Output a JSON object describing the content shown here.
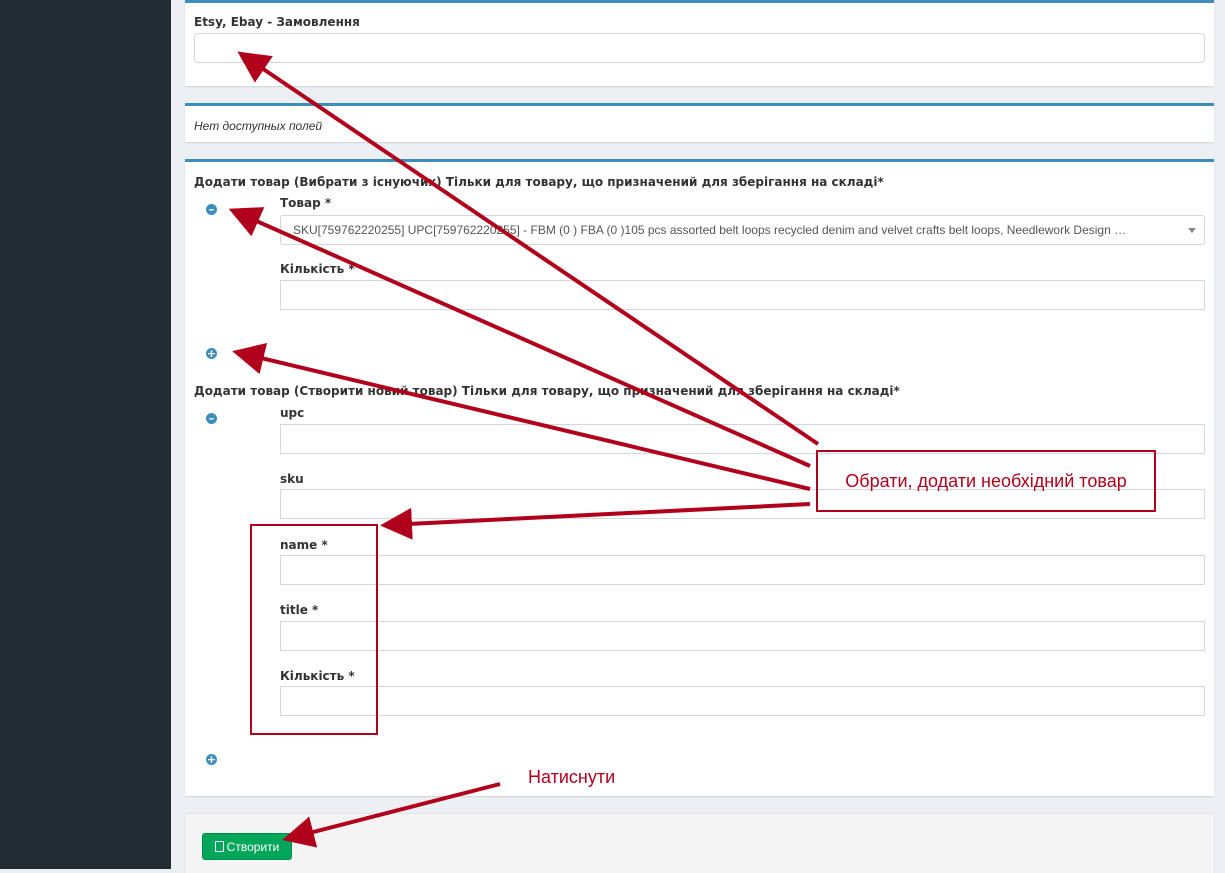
{
  "form": {
    "orders_label": "Etsy, Ebay - Замовлення",
    "orders_value": "",
    "no_fields_text": "Нет доступных полей",
    "existing_section_title": "Додати товар (Вибрати з існуючих) Тільки для товару, що призначений для зберігання на складі*",
    "product_label": "Товар *",
    "product_selected": "SKU[759762220255] UPC[759762220255] - FBM (0 ) FBA (0 )105 pcs assorted belt loops recycled denim and velvet crafts belt loops, Needlework Design …",
    "quantity_label": "Кількість *",
    "new_section_title": "Додати товар (Створити новий товар) Тільки для товару, що призначений для зберігання на складі*",
    "upc_label": "upc",
    "sku_label": "sku",
    "name_label": "name *",
    "title_label": "title *",
    "new_quantity_label": "Кількість *",
    "create_button": "Створити"
  },
  "annotations": {
    "callout_text": "Обрати, додати необхідний товар",
    "press_text": "Натиснути"
  },
  "icons": {
    "remove": "minus-circle-icon",
    "add": "plus-circle-icon",
    "file": "file-icon"
  },
  "colors": {
    "sidebar": "#222d32",
    "box_border": "#3c8dbc",
    "create_button": "#00a65a",
    "annotation": "#b1001c"
  }
}
